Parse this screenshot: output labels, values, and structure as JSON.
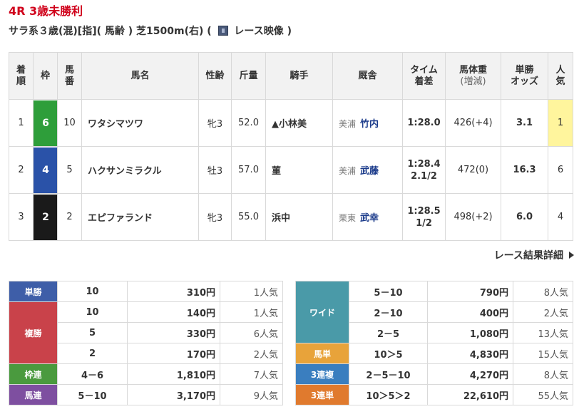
{
  "race": {
    "title": "4R 3歳未勝利",
    "conditions_text": "サラ系３歳(混)[指]( 馬齢 ) 芝1500m(右)  (",
    "video_label": "レース映像",
    "conditions_close": " )",
    "icon": "video-icon"
  },
  "results_table": {
    "headers": {
      "rank": [
        "着",
        "順"
      ],
      "waku": "枠",
      "umaban": [
        "馬",
        "番"
      ],
      "horse": "馬名",
      "sexage": "性齢",
      "weight": "斤量",
      "jockey": "騎手",
      "trainer": "厩舎",
      "time": [
        "タイム",
        "着差"
      ],
      "body": [
        "馬体重",
        "(増減)"
      ],
      "odds": [
        "単勝",
        "オッズ"
      ],
      "pop": [
        "人",
        "気"
      ]
    },
    "rows": [
      {
        "rank": "1",
        "waku": "6",
        "waku_bg": "#2e9e3a",
        "waku_fg": "#ffffff",
        "umaban": "10",
        "horse": "ワタシマツワ",
        "sexage": "牝3",
        "weight": "52.0",
        "jockey": "▲小林美",
        "trainer_area": "美浦",
        "trainer_name": "竹内",
        "time": "1:28.0",
        "margin": "",
        "body": "426(+4)",
        "odds": "3.1",
        "pop": "1"
      },
      {
        "rank": "2",
        "waku": "4",
        "waku_bg": "#2a52a8",
        "waku_fg": "#ffffff",
        "umaban": "5",
        "horse": "ハクサンミラクル",
        "sexage": "牡3",
        "weight": "57.0",
        "jockey": "菫",
        "trainer_area": "美浦",
        "trainer_name": "武藤",
        "time": "1:28.4",
        "margin": "2.1/2",
        "body": "472(0)",
        "odds": "16.3",
        "pop": "6"
      },
      {
        "rank": "3",
        "waku": "2",
        "waku_bg": "#1a1a1a",
        "waku_fg": "#ffffff",
        "umaban": "2",
        "horse": "エピファランド",
        "sexage": "牝3",
        "weight": "55.0",
        "jockey": "浜中",
        "trainer_area": "栗東",
        "trainer_name": "武幸",
        "time": "1:28.5",
        "margin": "1/2",
        "body": "498(+2)",
        "odds": "6.0",
        "pop": "4"
      }
    ]
  },
  "detail_link": "レース結果詳細",
  "payouts_left": {
    "tansho": {
      "label": "単勝",
      "rows": [
        {
          "num": "10",
          "amt": "310円",
          "pop": "1人気"
        }
      ]
    },
    "fukusho": {
      "label": "複勝",
      "rows": [
        {
          "num": "10",
          "amt": "140円",
          "pop": "1人気"
        },
        {
          "num": "5",
          "amt": "330円",
          "pop": "6人気"
        },
        {
          "num": "2",
          "amt": "170円",
          "pop": "2人気"
        }
      ]
    },
    "wakuren": {
      "label": "枠連",
      "rows": [
        {
          "num": "4－6",
          "amt": "1,810円",
          "pop": "7人気"
        }
      ]
    },
    "umaren": {
      "label": "馬連",
      "rows": [
        {
          "num": "5－10",
          "amt": "3,170円",
          "pop": "9人気"
        }
      ]
    }
  },
  "payouts_right": {
    "wide": {
      "label": "ワイド",
      "rows": [
        {
          "num": "5－10",
          "amt": "790円",
          "pop": "8人気"
        },
        {
          "num": "2－10",
          "amt": "400円",
          "pop": "2人気"
        },
        {
          "num": "2－5",
          "amt": "1,080円",
          "pop": "13人気"
        }
      ]
    },
    "umatan": {
      "label": "馬単",
      "rows": [
        {
          "num": "10＞5",
          "amt": "4,830円",
          "pop": "15人気"
        }
      ]
    },
    "sanrenpuku": {
      "label": "3連複",
      "rows": [
        {
          "num": "2－5－10",
          "amt": "4,270円",
          "pop": "8人気"
        }
      ]
    },
    "sanrentan": {
      "label": "3連単",
      "rows": [
        {
          "num": "10＞5＞2",
          "amt": "22,610円",
          "pop": "55人気"
        }
      ]
    }
  },
  "colors": {
    "title_red": "#d0021b",
    "link_blue": "#1a3a8a",
    "popular_highlight": "#fff59d",
    "tansho": "#3e5ea8",
    "fukusho": "#c9424a",
    "wakuren": "#4a9a3e",
    "umaren": "#7e4fa0",
    "wide": "#4a9aa8",
    "umatan": "#e8a33a",
    "sanrenpuku": "#3a7ebf",
    "sanrentan": "#e07a2e"
  }
}
